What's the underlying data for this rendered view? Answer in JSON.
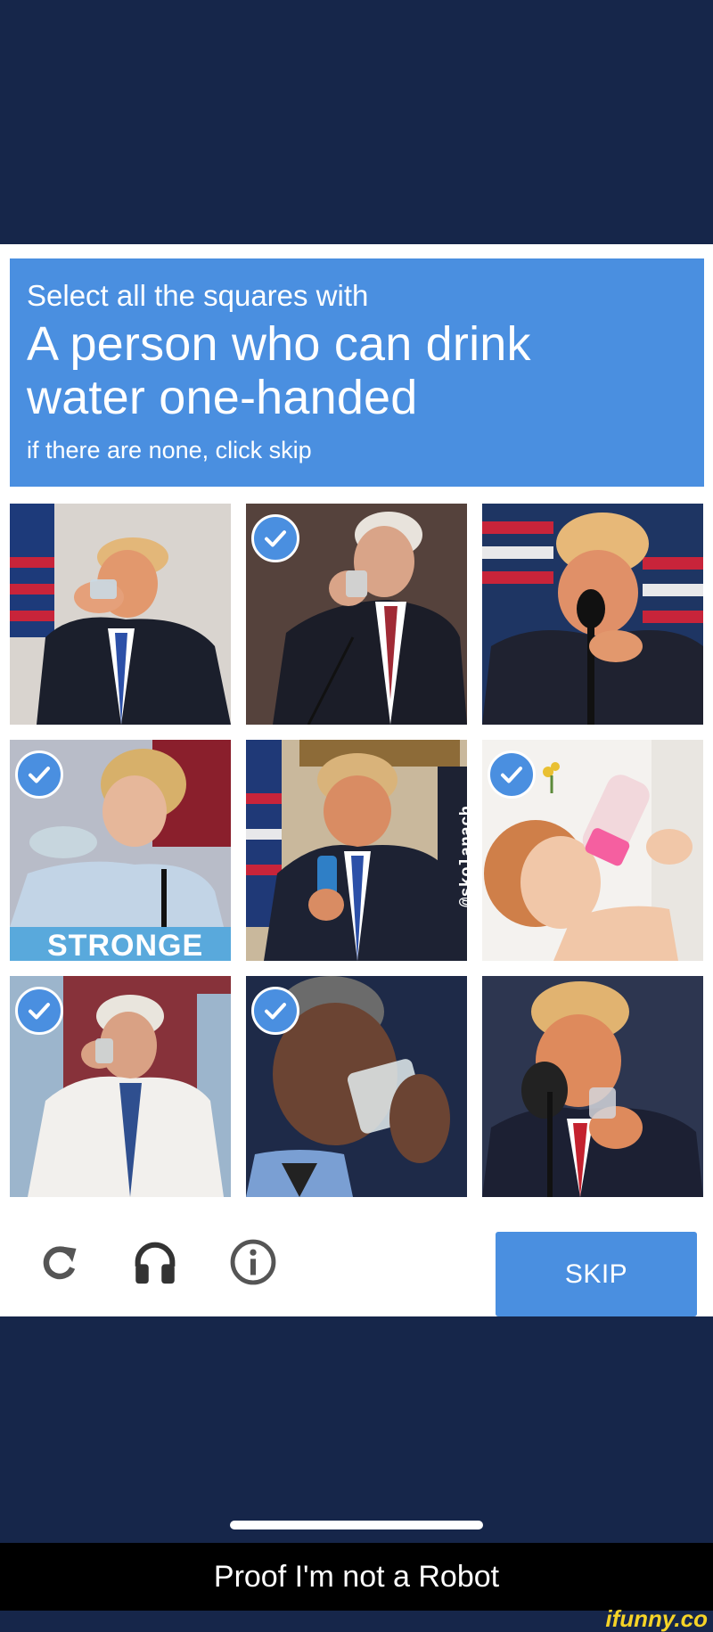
{
  "captcha": {
    "intro": "Select all the squares with",
    "keyword_line1": "A person who can drink",
    "keyword_line2": "water one-handed",
    "hint": "if there are none, click skip",
    "accent_color": "#4a8fe0",
    "tiles": [
      {
        "selected": false
      },
      {
        "selected": true
      },
      {
        "selected": false
      },
      {
        "selected": true,
        "overlay_text": "STRONGE"
      },
      {
        "selected": false,
        "watermark": "@skolanach"
      },
      {
        "selected": true
      },
      {
        "selected": true
      },
      {
        "selected": true
      },
      {
        "selected": false
      }
    ],
    "controls": {
      "reload_icon": "reload-icon",
      "audio_icon": "headphones-icon",
      "info_icon": "info-icon"
    },
    "skip_label": "SKIP"
  },
  "caption": "Proof I'm not a Robot",
  "watermark": "ifunny.co"
}
